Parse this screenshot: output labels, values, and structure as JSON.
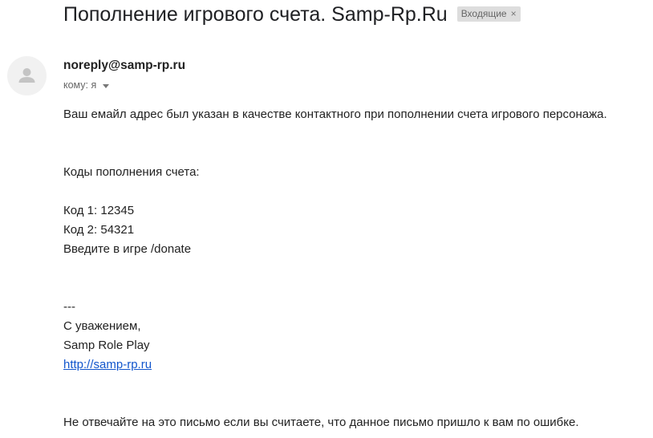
{
  "email": {
    "subject": "Пополнение игрового счета. Samp-Rp.Ru",
    "label": "Входящие",
    "label_close": "×",
    "sender": "noreply@samp-rp.ru",
    "recipient": "кому: я",
    "avatar_icon": "person-icon",
    "body": {
      "intro": "Ваш емайл адрес был указан в качестве контактного при пополнении счета игрового персонажа.",
      "codes_header": "Коды пополнения счета:",
      "code1": "Код 1: 12345",
      "code2": "Код 2: 54321",
      "instruction": "Введите в игре /donate",
      "separator": "---",
      "regards": "С уважением,",
      "signature": "Samp Role Play",
      "link": "http://samp-rp.ru",
      "footer": "Не отвечайте на это письмо если вы считаете, что данное письмо пришло к вам по ошибке."
    }
  },
  "colors": {
    "link": "#1155cc",
    "label_bg": "#dddddd",
    "avatar_bg": "#f1f1f1",
    "avatar_glyph": "#c4c4c4"
  }
}
